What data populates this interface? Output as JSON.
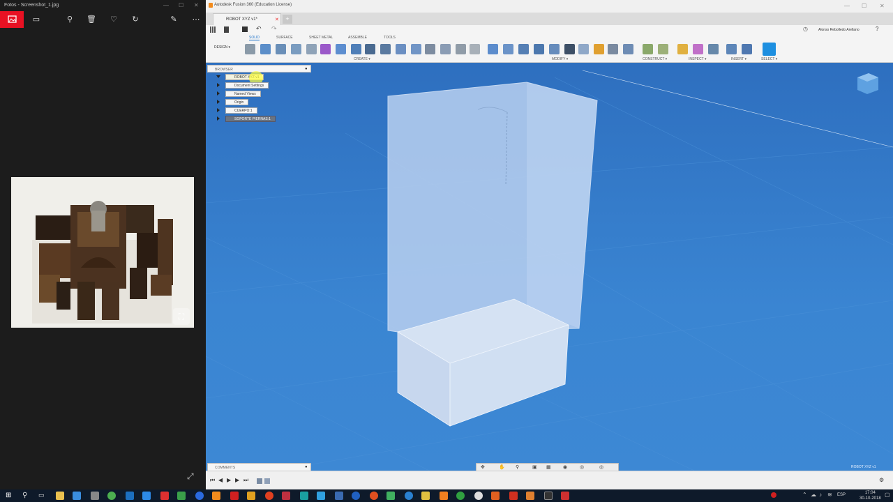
{
  "photos": {
    "title": "Fotos - Screenshot_1.jpg",
    "toolbar_icons": [
      "photo-icon",
      "slideshow-icon",
      "zoom-icon",
      "delete-icon",
      "favorite-icon",
      "rotate-icon",
      "edit-icon",
      "more-icon"
    ],
    "accent": "#e81123"
  },
  "fusion": {
    "window_title": "Autodesk Fusion 360 (Education License)",
    "doc_tab": "ROBOT XYZ v1*",
    "user": "Alonso Rebolledo Arellano",
    "design_button": "DESIGN ▾",
    "ribbon_tabs": [
      "SOLID",
      "SURFACE",
      "SHEET METAL",
      "ASSEMBLE",
      "TOOLS"
    ],
    "ribbon_groups": [
      "CREATE ▾",
      "MODIFY ▾",
      "CONSTRUCT ▾",
      "INSPECT ▾",
      "INSERT ▾",
      "SELECT ▾"
    ],
    "browser": {
      "title": "BROWSER",
      "items": [
        {
          "label": "ROBOT XYZ v1"
        },
        {
          "label": "Document Settings"
        },
        {
          "label": "Named Views"
        },
        {
          "label": "Origin"
        },
        {
          "label": "CUERPO:1"
        },
        {
          "label": "SOPORTE PIERNAS:1"
        }
      ]
    },
    "comments_title": "COMMENTS",
    "viewport_label": "ROBOT XYZ v1",
    "accent": "#1d72c9"
  },
  "taskbar": {
    "language": "ESP",
    "time": "17:04",
    "date": "30-10-2018"
  }
}
